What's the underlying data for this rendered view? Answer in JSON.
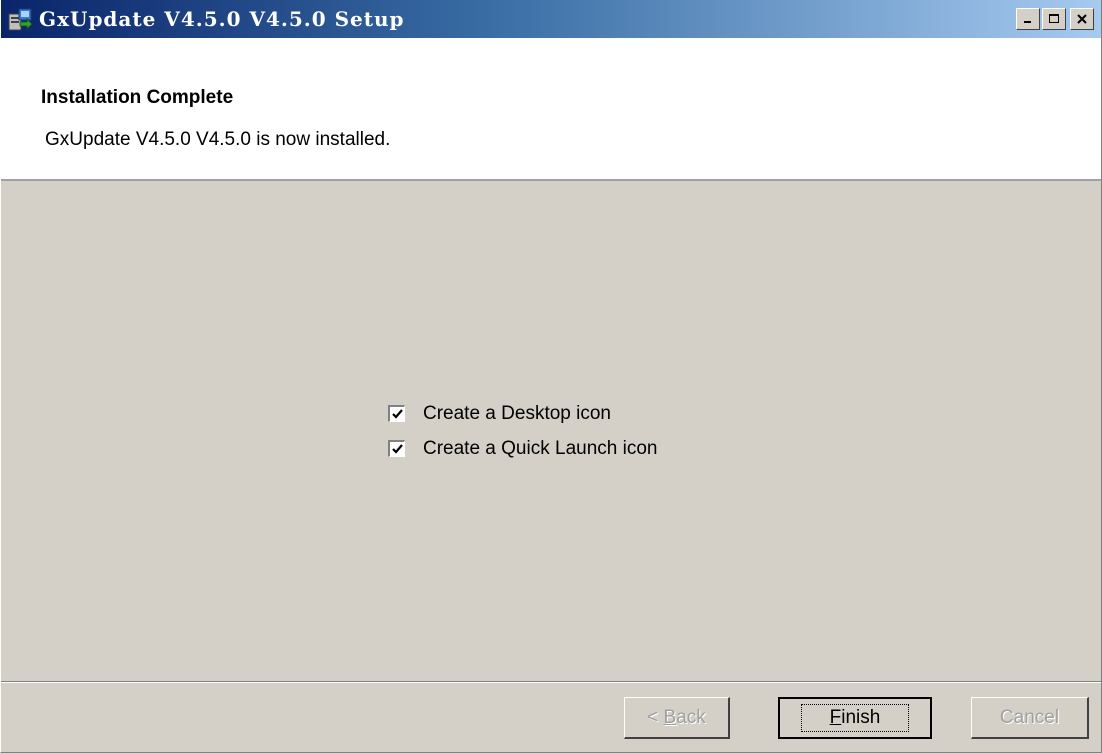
{
  "window": {
    "title": "GxUpdate V4.5.0 V4.5.0 Setup",
    "controls": [
      "minimize-icon",
      "maximize-icon",
      "close-icon"
    ]
  },
  "header": {
    "title": "Installation Complete",
    "subtitle": "GxUpdate V4.5.0 V4.5.0 is now installed."
  },
  "options": [
    {
      "label": "Create a Desktop icon",
      "checked": true
    },
    {
      "label": "Create a Quick Launch icon",
      "checked": true
    }
  ],
  "buttons": {
    "back": {
      "prefix": "< ",
      "accel": "B",
      "rest": "ack",
      "enabled": false
    },
    "finish": {
      "accel": "F",
      "rest": "inish",
      "enabled": true,
      "default": true
    },
    "cancel": {
      "label": "Cancel",
      "enabled": false
    }
  },
  "colors": {
    "titlebar_start": "#0a246a",
    "titlebar_end": "#a6caf0",
    "face": "#d4d0c8",
    "header_bg": "#ffffff"
  }
}
